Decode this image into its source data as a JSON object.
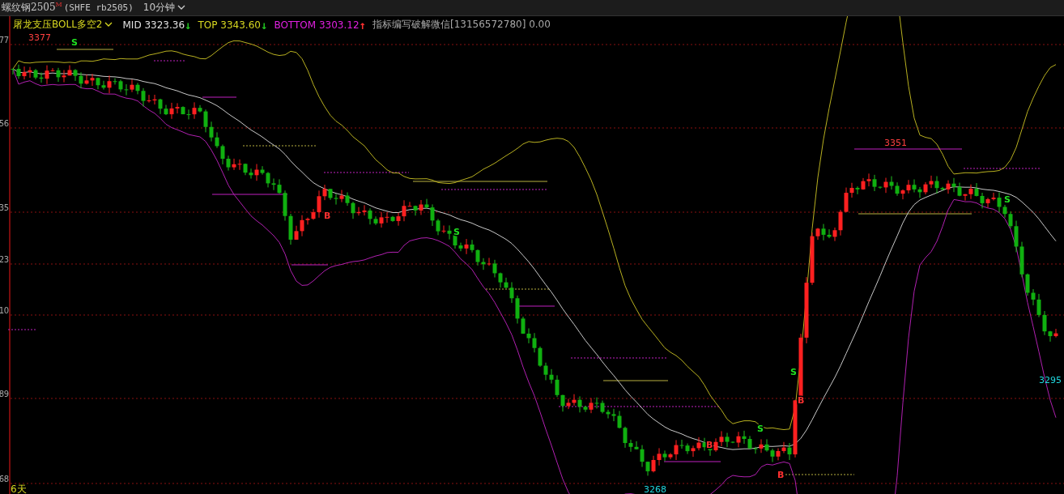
{
  "header": {
    "symbol": "螺纹钢2505",
    "symbol_mark": "M",
    "contract": "(SHFE rb2505)",
    "period": "10分钟"
  },
  "indicator": {
    "name": "屠龙支压BOLL多空2",
    "values": [
      {
        "kind": "mid",
        "label": "MID 3323.36",
        "arrow": "↓",
        "color": "#20c020"
      },
      {
        "kind": "top",
        "label": "TOP 3343.60",
        "arrow": "↓",
        "color": "#20c020"
      },
      {
        "kind": "bottom",
        "label": "BOTTOM 3303.12",
        "arrow": "↑",
        "color": "#ff3030"
      }
    ],
    "note": "指标编写破解微信[13156572780] 0.00"
  },
  "price_axis": [
    "77",
    "56",
    "35",
    "23",
    "10",
    "89",
    "68"
  ],
  "days_label": "6天",
  "price_labels": [
    {
      "text": "3377",
      "kind": "high"
    },
    {
      "text": "3351",
      "kind": "high"
    },
    {
      "text": "3295",
      "kind": "low"
    },
    {
      "text": "3268",
      "kind": "low"
    }
  ],
  "signals": [
    {
      "text": "S",
      "kind": "sell"
    },
    {
      "text": "B",
      "kind": "buy"
    },
    {
      "text": "S",
      "kind": "sell"
    },
    {
      "text": "B",
      "kind": "buy"
    },
    {
      "text": "S",
      "kind": "sell"
    },
    {
      "text": "B",
      "kind": "buy"
    },
    {
      "text": "S",
      "kind": "sell"
    },
    {
      "text": "B",
      "kind": "buy"
    },
    {
      "text": "S",
      "kind": "sell"
    }
  ]
}
